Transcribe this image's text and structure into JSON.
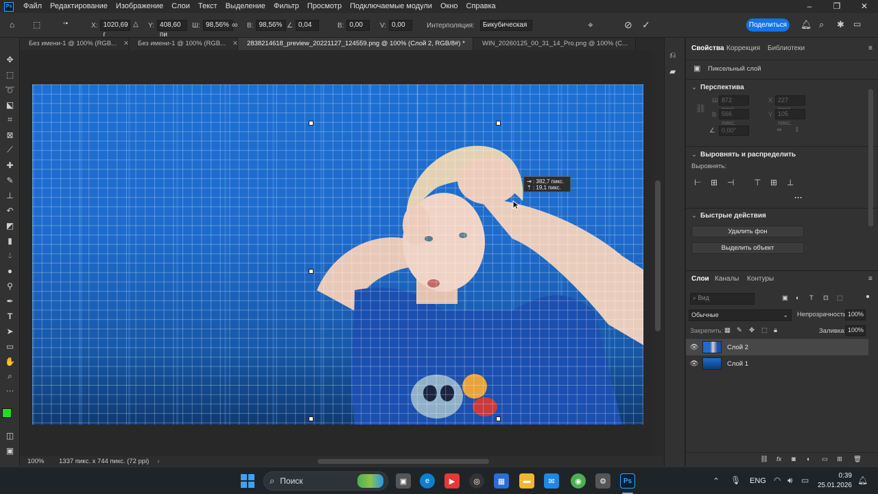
{
  "menu": {
    "items": [
      "Файл",
      "Редактирование",
      "Изображение",
      "Слои",
      "Текст",
      "Выделение",
      "Фильтр",
      "Просмотр",
      "Подключаемые модули",
      "Окно",
      "Справка"
    ]
  },
  "options": {
    "x_label": "X:",
    "x_value": "1020,69 г",
    "y_label": "Y:",
    "y_value": "408,60 пи",
    "w_label": "Ш:",
    "w_value": "98,56%",
    "h_label": "В:",
    "h_value": "98,56%",
    "angle_value": "0,04",
    "hskew_label": "В:",
    "hskew_value": "0,00",
    "vskew_label": "V:",
    "vskew_value": "0,00",
    "interp_label": "Интерполяция:",
    "interp_value": "Бикубическая",
    "share_label": "Поделиться"
  },
  "tabs": [
    {
      "label": "Без имени-1 @ 100% (RGB...",
      "active": false
    },
    {
      "label": "Без имени-1 @ 100% (RGB...",
      "active": false
    },
    {
      "label": "2838214618_preview_20221127_124559.png @ 100% (Слой 2, RGB/8#) *",
      "active": true
    },
    {
      "label": "WIN_20260125_00_31_14_Pro.png @ 100% (C...",
      "active": false
    }
  ],
  "tooltip": {
    "line1": "382,7 пикс.",
    "line2": "19,1 пикс."
  },
  "status": {
    "zoom": "100%",
    "doc_size": "1337 пикс. x 744 пикс. (72 ppi)"
  },
  "properties": {
    "tabs": [
      "Свойства",
      "Коррекция",
      "Библиотеки"
    ],
    "layer_kind": "Пиксельный слой",
    "perspective_title": "Перспектива",
    "w_label": "Ш",
    "w_value": "872 пикс.",
    "x_label": "X",
    "x_value": "227 пикс.",
    "h_label": "В",
    "h_value": "566 пикс.",
    "y_label": "Y",
    "y_value": "105 пикс.",
    "angle_value": "0,00°",
    "align_title": "Выровнять и распределить",
    "align_label": "Выровнять:",
    "quick_title": "Быстрые действия",
    "remove_bg": "Удалить фон",
    "select_subject": "Выделить объект"
  },
  "layers": {
    "tabs": [
      "Слои",
      "Каналы",
      "Контуры"
    ],
    "search_placeholder": "Вид",
    "blend_mode": "Обычные",
    "opacity_label": "Непрозрачность:",
    "opacity_value": "100%",
    "lock_label": "Закрепить:",
    "fill_label": "Заливка:",
    "fill_value": "100%",
    "items": [
      {
        "name": "Слой 2",
        "selected": true
      },
      {
        "name": "Слой 1",
        "selected": false
      }
    ]
  },
  "taskbar": {
    "search_label": "Поиск",
    "lang": "ENG",
    "time": "0:39",
    "date": "25.01.2026"
  }
}
